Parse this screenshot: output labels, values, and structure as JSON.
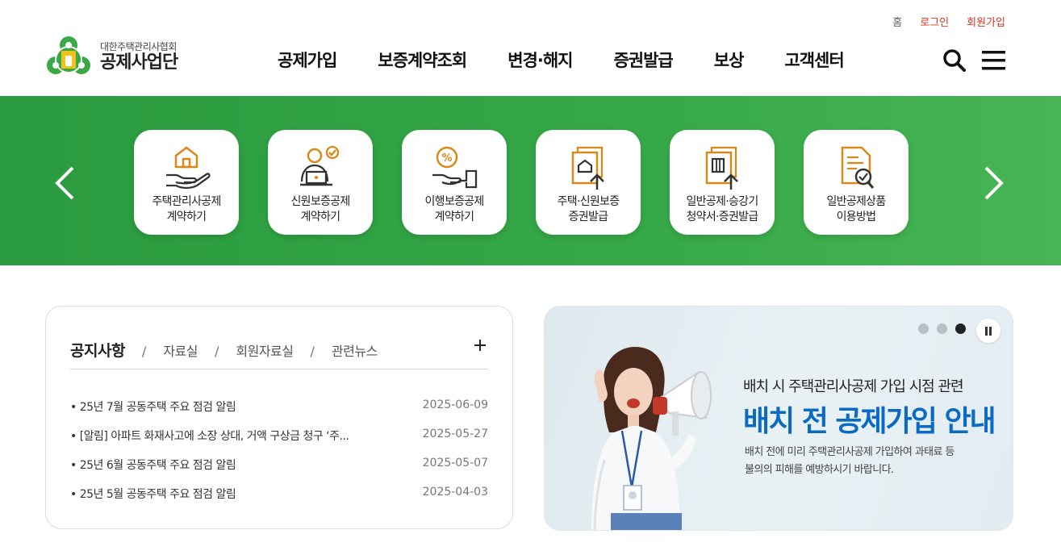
{
  "header": {
    "top_links": {
      "home": "홈",
      "login": "로그인",
      "join": "회원가입"
    },
    "logo": {
      "subtitle": "대한주택관리사협회",
      "title": "공제사업단"
    },
    "nav": [
      {
        "label": "공제가입"
      },
      {
        "label": "보증계약조회"
      },
      {
        "label": "변경·해지"
      },
      {
        "label": "증권발급"
      },
      {
        "label": "보상"
      },
      {
        "label": "고객센터"
      }
    ],
    "icons": [
      "search-icon",
      "menu-icon"
    ]
  },
  "quick_menu": {
    "items": [
      {
        "label": "주택관리사공제\n계약하기",
        "icon": "house-hand-icon"
      },
      {
        "label": "신원보증공제\n계약하기",
        "icon": "person-laptop-icon"
      },
      {
        "label": "이행보증공제\n계약하기",
        "icon": "coin-hand-icon"
      },
      {
        "label": "주택·신원보증\n증권발급",
        "icon": "house-document-icon"
      },
      {
        "label": "일반공제·승강기\n청약서·증권발급",
        "icon": "building-document-icon"
      },
      {
        "label": "일반공제상품\n이용방법",
        "icon": "document-search-icon"
      }
    ],
    "colors": {
      "band": "#36a847",
      "icon_accent": "#d9891a"
    }
  },
  "notice_board": {
    "tabs": [
      {
        "label": "공지사항",
        "active": true
      },
      {
        "label": "자료실"
      },
      {
        "label": "회원자료실"
      },
      {
        "label": "관련뉴스"
      }
    ],
    "separator": "/",
    "items": [
      {
        "title": "25년 7월 공동주택 주요 점검 알림",
        "date": "2025-06-09"
      },
      {
        "title": "[알림] 아파트 화재사고에 소장 상대, 거액 구상금 청구 ‘주...",
        "date": "2025-05-27"
      },
      {
        "title": "25년 6월 공동주택 주요 점검 알림",
        "date": "2025-05-07"
      },
      {
        "title": "25년 5월 공동주택 주요 점검 알림",
        "date": "2025-04-03"
      }
    ]
  },
  "banner": {
    "kicker": "배치 시 주택관리사공제 가입 시점 관련",
    "headline": "배치 전 공제가입 안내",
    "description": "배치 전에 미리 주택관리사공제 가입하여 과태료 등\n불의의 피해를 예방하시기 바랍니다.",
    "slide_count": 3,
    "active_slide": 3,
    "colors": {
      "headline": "#0a6ac4"
    }
  }
}
